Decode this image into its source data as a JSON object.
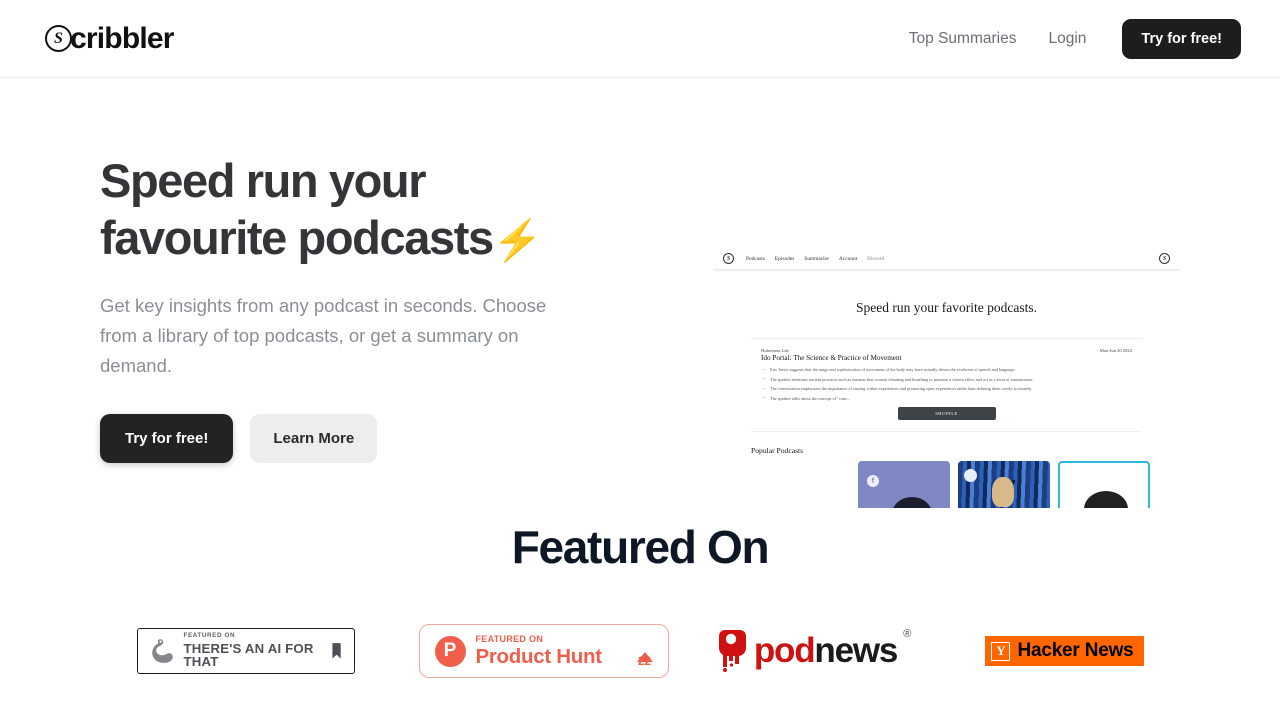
{
  "header": {
    "logo_text": "cribbler",
    "logo_mark_letter": "S",
    "nav": [
      {
        "label": "Top Summaries"
      },
      {
        "label": "Login"
      }
    ],
    "cta_label": "Try for free!"
  },
  "hero": {
    "title_line1": "Speed run your",
    "title_line2": "favourite podcasts",
    "title_emoji": "⚡",
    "subtitle": "Get key insights from any podcast in seconds. Choose from a library of top podcasts, or get a summary on demand.",
    "primary_cta": "Try for free!",
    "secondary_cta": "Learn More"
  },
  "mockup": {
    "logo_letter": "S",
    "nav": [
      {
        "label": "Podcasts"
      },
      {
        "label": "Episodes"
      },
      {
        "label": "Summarize"
      },
      {
        "label": "Account"
      },
      {
        "label": "Discord"
      }
    ],
    "hero_title": "Speed run your favorite podcasts.",
    "card": {
      "show": "Huberman Lab",
      "date": "Mon Jun 20 2022",
      "episode": "Ido Portal: The Science & Practice of Movement",
      "bullets": [
        "Eric Jarvis suggests that the range and sophistication of movement of the body may have actually driven the evolution of speech and language.",
        "The speaker mentions ancient practices such as mantras that contain vibrating and breathing to promote a certain effect and act as a form of transmission.",
        "The conversation emphasizes the importance of staying within experiences and promoting open experiences rather than defining them overly accurately.",
        "The speaker talks about the concept of \"cons..."
      ],
      "shuffle_label": "SHUFFLE"
    },
    "popular_heading": "Popular Podcasts",
    "thumb_badge": "f"
  },
  "featured": {
    "title": "Featured On",
    "badges": {
      "taaft": {
        "small": "FEATURED ON",
        "big": "THERE'S AN AI FOR THAT"
      },
      "product_hunt": {
        "small": "FEATURED ON",
        "big": "Product Hunt",
        "votes": "22"
      },
      "podnews": {
        "part1": "pod",
        "part2": "news",
        "registered": "®"
      },
      "hacker_news": {
        "y": "Y",
        "label": "Hacker News"
      }
    }
  },
  "colors": {
    "dark": "#1d1d1d",
    "muted": "#8a8f96",
    "product_hunt": "#ef5f4c",
    "podnews_red": "#cf1111",
    "hacker_news_orange": "#ff6600",
    "featured_title": "#0e1726"
  }
}
